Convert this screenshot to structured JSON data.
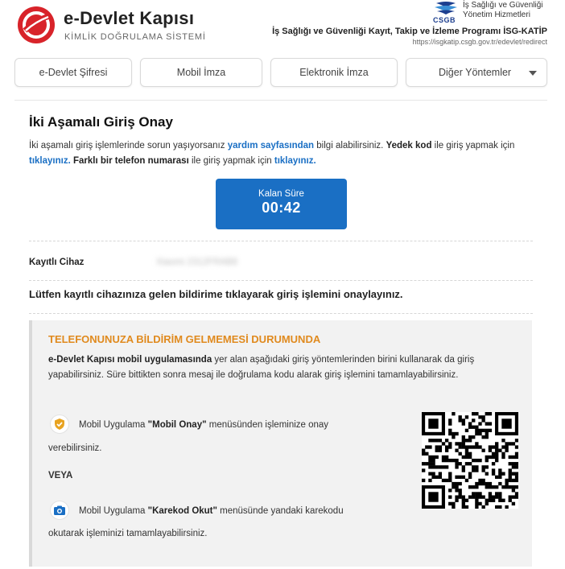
{
  "header": {
    "brand_title": "e-Devlet Kapısı",
    "brand_subtitle": "KİMLİK DOĞRULAMA SİSTEMİ",
    "ministry_logo_text": "CSGB",
    "ministry_line1": "İş Sağlığı ve Güvenliği",
    "ministry_line2": "Yönetim Hizmetleri",
    "program_title": "İş Sağlığı ve Güvenliği Kayıt, Takip ve İzleme Programı İSG-KATİP",
    "program_url": "https://isgkatip.csgb.gov.tr/edevlet/redirect"
  },
  "tabs": [
    {
      "label": "e-Devlet Şifresi"
    },
    {
      "label": "Mobil İmza"
    },
    {
      "label": "Elektronik İmza"
    },
    {
      "label": "Diğer Yöntemler"
    }
  ],
  "main": {
    "title": "İki Aşamalı Giriş Onay",
    "intro_text_1": "İki aşamalı giriş işlemlerinde sorun yaşıyorsanız ",
    "help_link": "yardım sayfasından",
    "intro_text_2": " bilgi alabilirsiniz. ",
    "backup_code_label": "Yedek kod",
    "intro_text_3": " ile giriş yapmak için ",
    "click_link_1": "tıklayınız.",
    "other_phone_label": "Farklı bir telefon numarası",
    "intro_text_4": " ile giriş yapmak için ",
    "click_link_2": "tıklayınız.",
    "timer_label": "Kalan Süre",
    "timer_value": "00:42",
    "device_label": "Kayıtlı Cihaz",
    "device_value": "Xiaomi 2312FRAB8",
    "confirm_message": "Lütfen kayıtlı cihazınıza gelen bildirime tıklayarak giriş işlemini onaylayınız."
  },
  "infobox": {
    "title": "TELEFONUNUZA BİLDİRİM GELMEMESİ DURUMUNDA",
    "body_bold": "e-Devlet Kapısı mobil uygulamasında",
    "body_rest": " yer alan aşağıdaki giriş yöntemlerinden birini kullanarak da giriş yapabilirsiniz. Süre bittikten sonra mesaj ile doğrulama kodu alarak giriş işlemini tamamlayabilirsiniz.",
    "option1_prefix": "Mobil Uygulama ",
    "option1_bold": "\"Mobil Onay\"",
    "option1_suffix": " menüsünden işleminize onay",
    "option1_line2": "verebilirsiniz.",
    "or_label": "VEYA",
    "option2_prefix": "Mobil Uygulama ",
    "option2_bold": "\"Karekod Okut\"",
    "option2_suffix": " menüsünde yandaki karekodu",
    "option2_line2": "okutarak işleminizi tamamlayabilirsiniz."
  },
  "colors": {
    "accent_blue": "#1a6fc4",
    "warning_orange": "#e08a1e",
    "brand_red": "#d8232a"
  },
  "icons": [
    "edevlet-logo-icon",
    "csgb-logo-icon",
    "chevron-down-icon",
    "shield-check-icon",
    "camera-icon",
    "qr-code"
  ]
}
